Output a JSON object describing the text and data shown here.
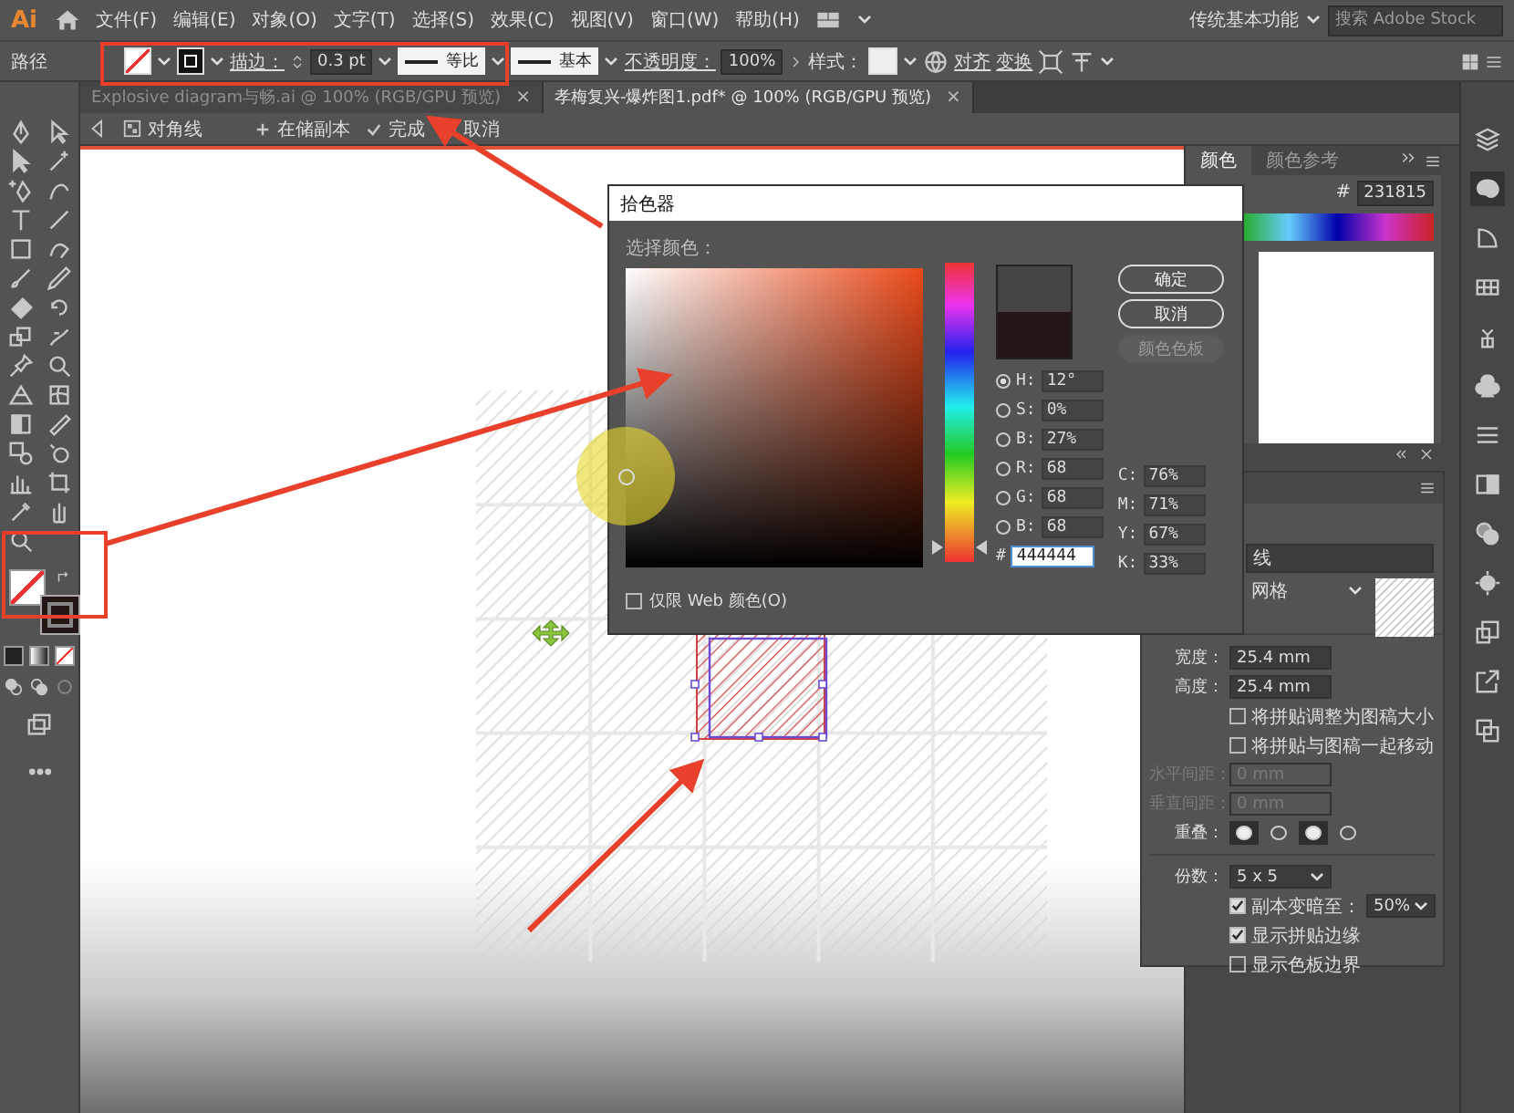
{
  "menu_bar": {
    "logo": "Ai",
    "items": [
      "文件(F)",
      "编辑(E)",
      "对象(O)",
      "文字(T)",
      "选择(S)",
      "效果(C)",
      "视图(V)",
      "窗口(W)",
      "帮助(H)"
    ],
    "workspace": "传统基本功能",
    "search": {
      "placeholder": "搜索 Adobe Stock"
    }
  },
  "control_bar": {
    "object_type": "路径",
    "stroke_label": "描边：",
    "stroke_weight": "0.3 pt",
    "profile": "等比",
    "brush": "基本",
    "opacity_label": "不透明度：",
    "opacity": "100%",
    "style_label": "样式：",
    "buttons": [
      "对齐",
      "变换"
    ]
  },
  "document_tabs": [
    {
      "label": "Explosive diagram与畅.ai @ 100% (RGB/GPU 预览)",
      "selected": false,
      "close": "×"
    },
    {
      "label": "孝梅复兴-爆炸图1.pdf* @ 100% (RGB/GPU 预览)",
      "selected": true,
      "close": "×"
    }
  ],
  "pattern_edit_bar": {
    "pattern_name": "对角线",
    "actions": [
      {
        "kind": "save",
        "label": "在储副本"
      },
      {
        "kind": "done",
        "label": "完成"
      },
      {
        "kind": "cancel",
        "label": "取消"
      }
    ]
  },
  "color_picker": {
    "title": "拾色器",
    "prompt": "选择颜色：",
    "hue_slider": {
      "level": 0.05
    },
    "buttons": [
      {
        "label": "确定",
        "disabled": false
      },
      {
        "label": "取消",
        "disabled": false
      },
      {
        "label": "颜色色板",
        "disabled": true
      }
    ],
    "fields": [
      {
        "label": "H:",
        "value": "12°",
        "selected": true
      },
      {
        "label": "S:",
        "value": "0%",
        "selected": false
      },
      {
        "label": "B:",
        "value": "27%",
        "selected": false
      },
      {
        "label": "R:",
        "value": "68",
        "selected": false
      },
      {
        "label": "G:",
        "value": "68",
        "selected": false
      },
      {
        "label": "B:",
        "value": "68",
        "selected": false
      }
    ],
    "hex": {
      "label": "#",
      "value": "444444"
    },
    "cmyk": [
      {
        "label": "C:",
        "value": "76%"
      },
      {
        "label": "M:",
        "value": "71%"
      },
      {
        "label": "Y:",
        "value": "67%"
      },
      {
        "label": "K:",
        "value": "33%"
      }
    ],
    "web_only": {
      "label": "仅限 Web 颜色(O)",
      "checked": false
    }
  },
  "color_panel": {
    "tabs": [
      {
        "label": "颜色",
        "selected": true
      },
      {
        "label": "颜色参考",
        "selected": false
      }
    ],
    "hex_label": "#",
    "hex": "231815"
  },
  "pattern_options": {
    "name": "线",
    "tile_type": "网格",
    "size": [
      {
        "label": "宽度：",
        "value": "25.4 mm"
      },
      {
        "label": "高度：",
        "value": "25.4 mm"
      }
    ],
    "checkboxes": [
      {
        "label": "将拼贴调整为图稿大小",
        "checked": false
      },
      {
        "label": "将拼贴与图稿一起移动",
        "checked": false
      }
    ],
    "spacing": [
      {
        "label": "水平间距：",
        "value": "0 mm",
        "disabled": true
      },
      {
        "label": "垂直间距：",
        "value": "0 mm",
        "disabled": true
      }
    ],
    "overlap_label": "重叠：",
    "overlap_buttons": [
      {
        "selected": true
      },
      {
        "selected": false
      },
      {
        "selected": true
      },
      {
        "selected": false
      }
    ],
    "copies": {
      "label": "份数：",
      "value": "5 x 5"
    },
    "dim": {
      "label": "副本变暗至：",
      "checked": true,
      "value": "50%"
    },
    "options": [
      {
        "label": "显示拼贴边缘",
        "checked": true
      },
      {
        "label": "显示色板边界",
        "checked": false
      }
    ]
  }
}
